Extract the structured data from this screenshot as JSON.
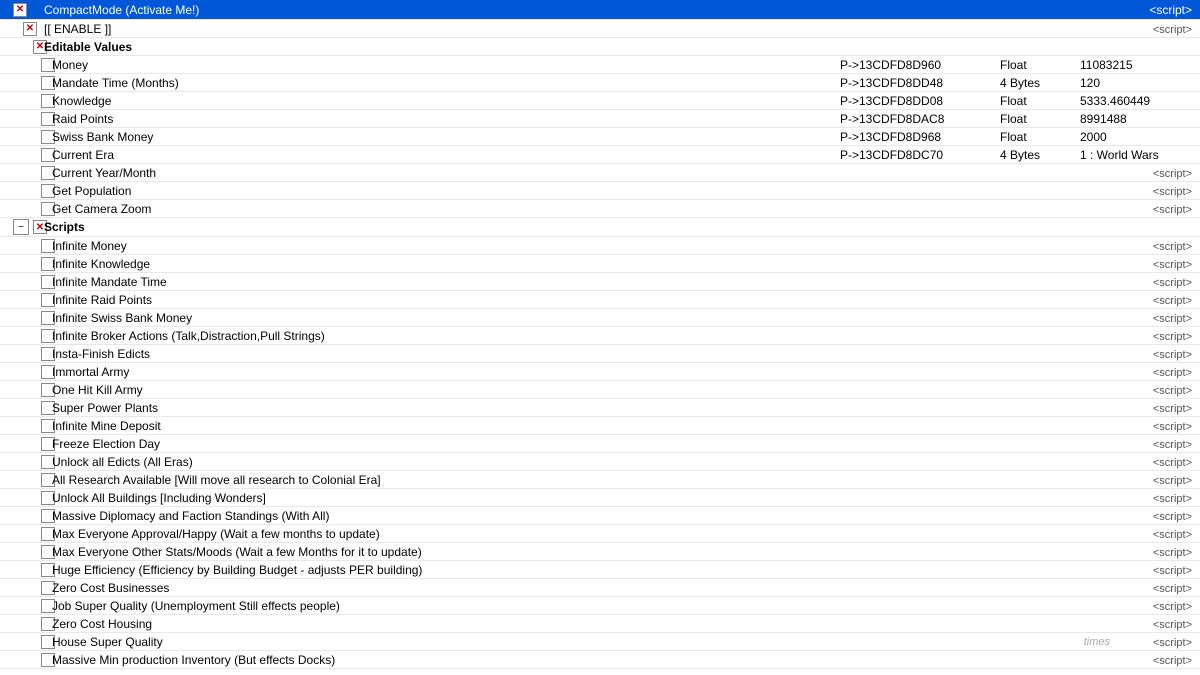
{
  "header": {
    "title": "CompactMode (Activate  Me!)",
    "script_tag": "<script>"
  },
  "enable_row": {
    "label": "[[ ENABLE ]]",
    "script_tag": "<script>"
  },
  "editable_values_header": {
    "label": "Editable Values"
  },
  "editable_items": [
    {
      "name": "Money",
      "address": "P->13CDFD8D960",
      "type": "Float",
      "value": "11083215",
      "checked": false
    },
    {
      "name": "Mandate Time (Months)",
      "address": "P->13CDFD8DD48",
      "type": "4 Bytes",
      "value": "120",
      "checked": false
    },
    {
      "name": "Knowledge",
      "address": "P->13CDFD8DD08",
      "type": "Float",
      "value": "5333.460449",
      "checked": false
    },
    {
      "name": "Raid Points",
      "address": "P->13CDFD8DAC8",
      "type": "Float",
      "value": "8991488",
      "checked": false
    },
    {
      "name": "Swiss Bank Money",
      "address": "P->13CDFD8D968",
      "type": "Float",
      "value": "2000",
      "checked": false
    },
    {
      "name": "Current Era",
      "address": "P->13CDFD8DC70",
      "type": "4 Bytes",
      "value": "1 : World Wars",
      "checked": false
    },
    {
      "name": "Current Year/Month",
      "address": "",
      "type": "",
      "value": "",
      "script": "<script>",
      "checked": false
    },
    {
      "name": "Get Population",
      "address": "",
      "type": "",
      "value": "",
      "script": "<script>",
      "checked": false
    },
    {
      "name": "Get Camera Zoom",
      "address": "",
      "type": "",
      "value": "",
      "script": "<script>",
      "checked": false
    }
  ],
  "scripts_section": {
    "label": "Scripts"
  },
  "script_items": [
    {
      "name": "Infinite Money",
      "checked": false
    },
    {
      "name": "Infinite Knowledge",
      "checked": false
    },
    {
      "name": "Infinite Mandate Time",
      "checked": false
    },
    {
      "name": "Infinite Raid Points",
      "checked": false
    },
    {
      "name": "Infinite Swiss Bank Money",
      "checked": false
    },
    {
      "name": "Infinite Broker Actions (Talk,Distraction,Pull Strings)",
      "checked": false
    },
    {
      "name": "Insta-Finish Edicts",
      "checked": false
    },
    {
      "name": "Immortal Army",
      "checked": false
    },
    {
      "name": "One Hit Kill Army",
      "checked": false
    },
    {
      "name": "Super Power Plants",
      "checked": false
    },
    {
      "name": "Infinite Mine Deposit",
      "checked": false
    },
    {
      "name": "Freeze Election Day",
      "checked": false
    },
    {
      "name": "Unlock all Edicts (All Eras)",
      "checked": false
    },
    {
      "name": "All Research Available [Will move all research to Colonial Era]",
      "checked": false
    },
    {
      "name": "Unlock All Buildings [Including Wonders]",
      "checked": false
    },
    {
      "name": "Massive Diplomacy and Faction Standings (With All)",
      "checked": false
    },
    {
      "name": "Max Everyone Approval/Happy (Wait a few months to update)",
      "checked": false
    },
    {
      "name": "Max Everyone Other Stats/Moods (Wait a few Months for it to update)",
      "checked": false
    },
    {
      "name": "Huge Efficiency (Efficiency by Building Budget - adjusts PER building)",
      "checked": false
    },
    {
      "name": "Zero Cost Businesses",
      "checked": false
    },
    {
      "name": "Job Super Quality (Unemployment Still effects people)",
      "checked": false
    },
    {
      "name": "Zero Cost Housing",
      "checked": false
    },
    {
      "name": "House Super Quality",
      "checked": false
    },
    {
      "name": "Massive Min production Inventory (But effects Docks)",
      "checked": false
    }
  ],
  "labels": {
    "script": "<script>",
    "address_prefix": "P->",
    "times_watermark": "times"
  }
}
